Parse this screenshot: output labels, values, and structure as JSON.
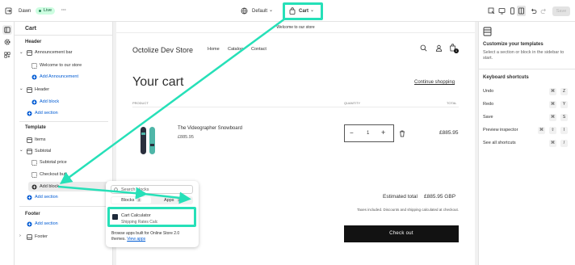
{
  "topbar": {
    "store": "Dawn",
    "status": "Live",
    "more": "···",
    "theme_selector": "Default",
    "page_selector": "Cart",
    "save": "Save"
  },
  "sidebar": {
    "title": "Cart",
    "header_group_label": "Header",
    "announcement_bar": "Announcement bar",
    "welcome_block": "Welcome to our store",
    "add_announcement": "Add Announcement",
    "header_section": "Header",
    "add_block_header": "Add block",
    "add_section_header": "Add section",
    "template_label": "Template",
    "items": "Items",
    "subtotal": "Subtotal",
    "subtotal_price": "Subtotal price",
    "checkout_buttons": "Checkout butt",
    "add_block_template": "Add block",
    "add_section_template": "Add section",
    "footer_label": "Footer",
    "add_section_footer": "Add section",
    "footer": "Footer"
  },
  "preview": {
    "announcement": "Welcome to our store",
    "store_name": "Octolize Dev Store",
    "nav": [
      "Home",
      "Catalog",
      "Contact"
    ],
    "cart_count": "1",
    "heading": "Your cart",
    "continue_shopping": "Continue shopping",
    "col_product": "PRODUCT",
    "col_quantity": "QUANTITY",
    "col_total": "TOTAL",
    "product_name": "The Videographer Snowboard",
    "product_price": "£885.95",
    "quantity": "1",
    "line_total": "£885.95",
    "estimated_label": "Estimated total",
    "estimated_value": "£885.95 GBP",
    "taxes_note": "Taxes included. Discounts and shipping calculated at checkout.",
    "checkout": "Check out"
  },
  "popup": {
    "search_placeholder": "Search blocks",
    "tab_blocks": "Blocks",
    "tab_blocks_count": "3",
    "tab_apps": "Apps",
    "tab_apps_count": "1",
    "app_name": "Cart Calculator",
    "app_sub": "Shipping Rates Calc",
    "browse_text": "Browse apps built for Online Store 2.0 themes.",
    "view_apps": "View apps"
  },
  "rightpanel": {
    "title": "Customize your templates",
    "desc": "Select a section or block in the sidebar to start.",
    "shortcuts_title": "Keyboard shortcuts",
    "shortcuts": [
      {
        "label": "Undo",
        "keys": [
          "⌘",
          "Z"
        ]
      },
      {
        "label": "Redo",
        "keys": [
          "⌘",
          "Y"
        ]
      },
      {
        "label": "Save",
        "keys": [
          "⌘",
          "S"
        ]
      },
      {
        "label": "Preview inspector",
        "keys": [
          "⌘",
          "⇧",
          "I"
        ]
      },
      {
        "label": "See all shortcuts",
        "keys": [
          "⌘",
          "/"
        ]
      }
    ]
  },
  "colors": {
    "highlight": "#26e0b8",
    "link": "#005bd3",
    "live_bg": "#cdfee1"
  }
}
